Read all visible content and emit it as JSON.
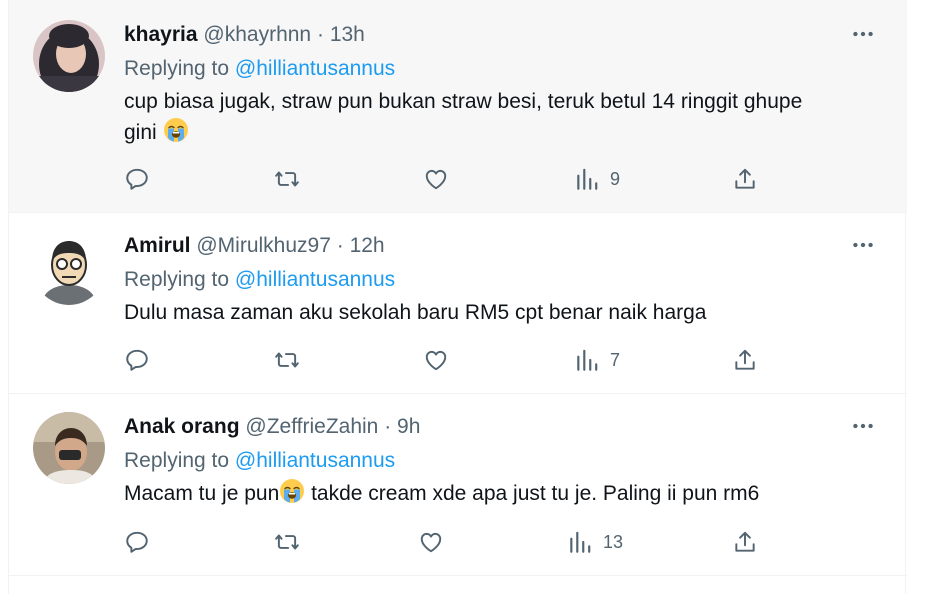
{
  "tweets": [
    {
      "name": "khayria",
      "handle": "@khayrhnn",
      "sep": "·",
      "time": "13h",
      "replying_prefix": "Replying to",
      "replying_to": "@hilliantusannus",
      "text_line1": "cup biasa jugak, straw pun bukan straw besi, teruk betul 14 ringgit ghupe",
      "text_line2": "gini",
      "views": "9"
    },
    {
      "name": "Amirul",
      "handle": "@Mirulkhuz97",
      "sep": "·",
      "time": "12h",
      "replying_prefix": "Replying to",
      "replying_to": "@hilliantusannus",
      "text": "Dulu masa zaman aku sekolah baru RM5 cpt benar naik harga",
      "views": "7"
    },
    {
      "name": "Anak orang",
      "handle": "@ZeffrieZahin",
      "sep": "·",
      "time": "9h",
      "replying_prefix": "Replying to",
      "replying_to": "@hilliantusannus",
      "text_before": "Macam tu je pun",
      "text_after": " takde cream xde apa just tu je. Paling ii pun rm6",
      "views": "13"
    }
  ],
  "colors": {
    "text": "#0f1419",
    "muted": "#536471",
    "link": "#1d9bf0",
    "highlight_bg": "#f7f7f7"
  },
  "icons": [
    "more-icon",
    "reply-icon",
    "retweet-icon",
    "like-icon",
    "views-icon",
    "share-icon",
    "crying-face-emoji"
  ]
}
